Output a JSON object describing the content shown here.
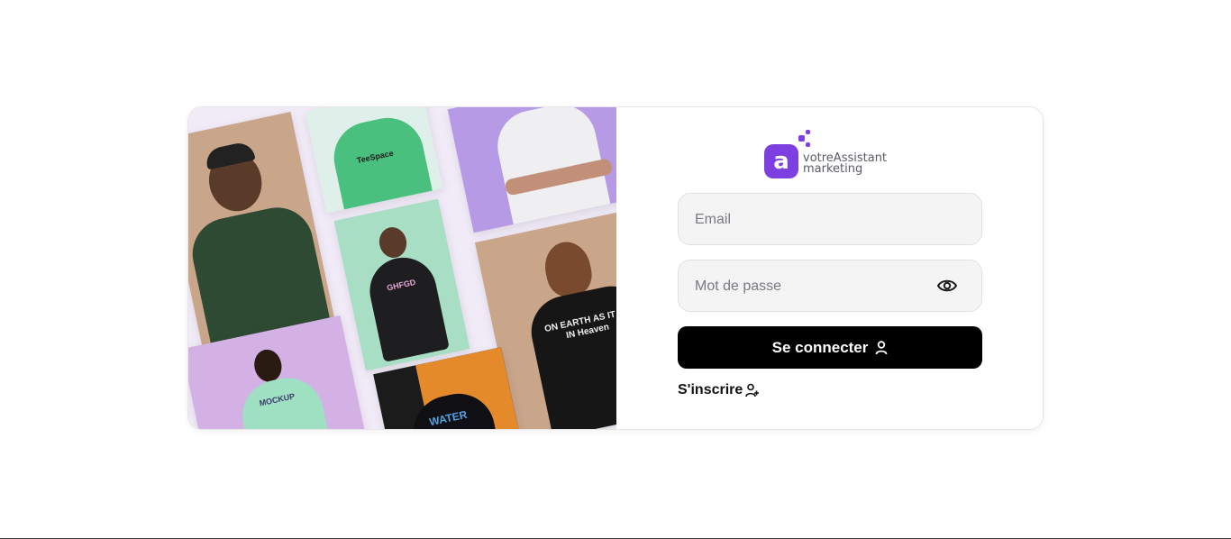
{
  "logo": {
    "line1": "votreAssistant",
    "line2": "marketing",
    "mark": "a",
    "brand_color": "#7d3fe0"
  },
  "form": {
    "email_placeholder": "Email",
    "password_placeholder": "Mot de passe",
    "login_label": "Se connecter",
    "signup_label": "S'inscrire"
  },
  "icons": {
    "password_toggle": "eye-icon",
    "login": "user-icon",
    "signup": "user-plus-icon"
  },
  "colors": {
    "button_bg": "#000000",
    "field_bg": "#f4f4f5",
    "collage_bg": "#f1ebf8"
  },
  "collage": {
    "garment_prints": [
      "TeeSpace",
      "GHFGD",
      "ON EARTH AS IT IS IN Heaven",
      "MOCKUP",
      "WATER"
    ]
  }
}
